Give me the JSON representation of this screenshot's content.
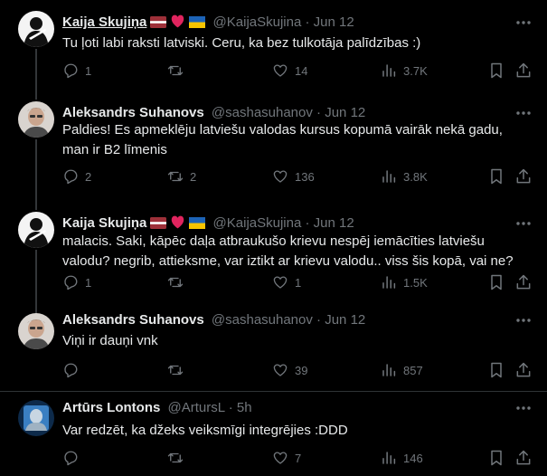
{
  "colors": {
    "background": "#000000",
    "text": "#e7e9ea",
    "muted": "#71767b",
    "divider": "#2f3336",
    "like": "#f91880"
  },
  "tweets": [
    {
      "name": "Kaija Skujiņa",
      "handle": "@KaijaSkujina",
      "dot": "·",
      "time": "Jun 12",
      "text": "Tu ļoti labi raksti latviski. Ceru, ka bez tulkotāja palīdzības :)",
      "replies": "1",
      "retweets": "",
      "likes": "14",
      "views": "3.7K",
      "icons": [
        "more-icon",
        "reply-icon",
        "retweet-icon",
        "heart-icon",
        "views-icon",
        "bookmark-icon",
        "share-icon"
      ]
    },
    {
      "name": "Aleksandrs Suhanovs",
      "handle": "@sashasuhanov",
      "dot": "·",
      "time": "Jun 12",
      "text": "Paldies! Es apmeklēju latviešu valodas kursus kopumā vairāk nekā gadu, man ir B2 līmenis",
      "replies": "2",
      "retweets": "2",
      "likes": "136",
      "views": "3.8K"
    },
    {
      "name": "Kaija Skujiņa",
      "handle": "@KaijaSkujina",
      "dot": "·",
      "time": "Jun 12",
      "text": "malacis. Saki, kāpēc daļa atbraukušo krievu nespēj iemācīties latviešu valodu? negrib, attieksme, var iztikt ar krievu valodu.. viss šis kopā, vai ne?",
      "replies": "1",
      "retweets": "",
      "likes": "1",
      "views": "1.5K"
    },
    {
      "name": "Aleksandrs Suhanovs",
      "handle": "@sashasuhanov",
      "dot": "·",
      "time": "Jun 12",
      "text": "Viņi ir dauņi vnk",
      "replies": "",
      "retweets": "",
      "likes": "39",
      "views": "857"
    },
    {
      "name": "Artūrs Lontons",
      "handle": "@ArtursL",
      "dot": "·",
      "time": "5h",
      "text": "Var redzēt, ka džeks veiksmīgi  integrējies :DDD",
      "replies": "",
      "retweets": "",
      "likes": "7",
      "views": "146"
    }
  ]
}
